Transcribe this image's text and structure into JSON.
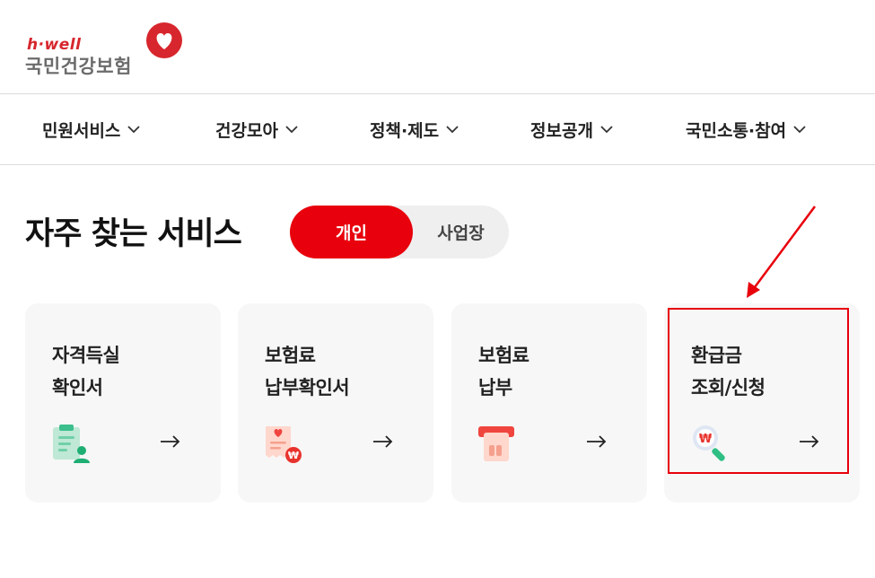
{
  "logo": {
    "small_text": "h·well",
    "main_text": "국민건강보험",
    "brand_color": "#d7262d"
  },
  "nav": {
    "items": [
      {
        "label": "민원서비스"
      },
      {
        "label": "건강모아"
      },
      {
        "label": "정책·제도"
      },
      {
        "label": "정보공개"
      },
      {
        "label": "국민소통·참여"
      }
    ]
  },
  "section": {
    "title": "자주 찾는 서비스"
  },
  "toggle": {
    "active_label": "개인",
    "inactive_label": "사업장",
    "accent_color": "#e8000c"
  },
  "cards": [
    {
      "line1": "자격득실",
      "line2": "확인서",
      "icon": "qualification-certificate-icon"
    },
    {
      "line1": "보험료",
      "line2": "납부확인서",
      "icon": "payment-receipt-icon"
    },
    {
      "line1": "보험료",
      "line2": "납부",
      "icon": "card-payment-icon"
    },
    {
      "line1": "환급금",
      "line2": "조회/신청",
      "icon": "refund-search-icon"
    }
  ],
  "annotation": {
    "highlight_color": "#e8000c",
    "target": "refund-card"
  }
}
